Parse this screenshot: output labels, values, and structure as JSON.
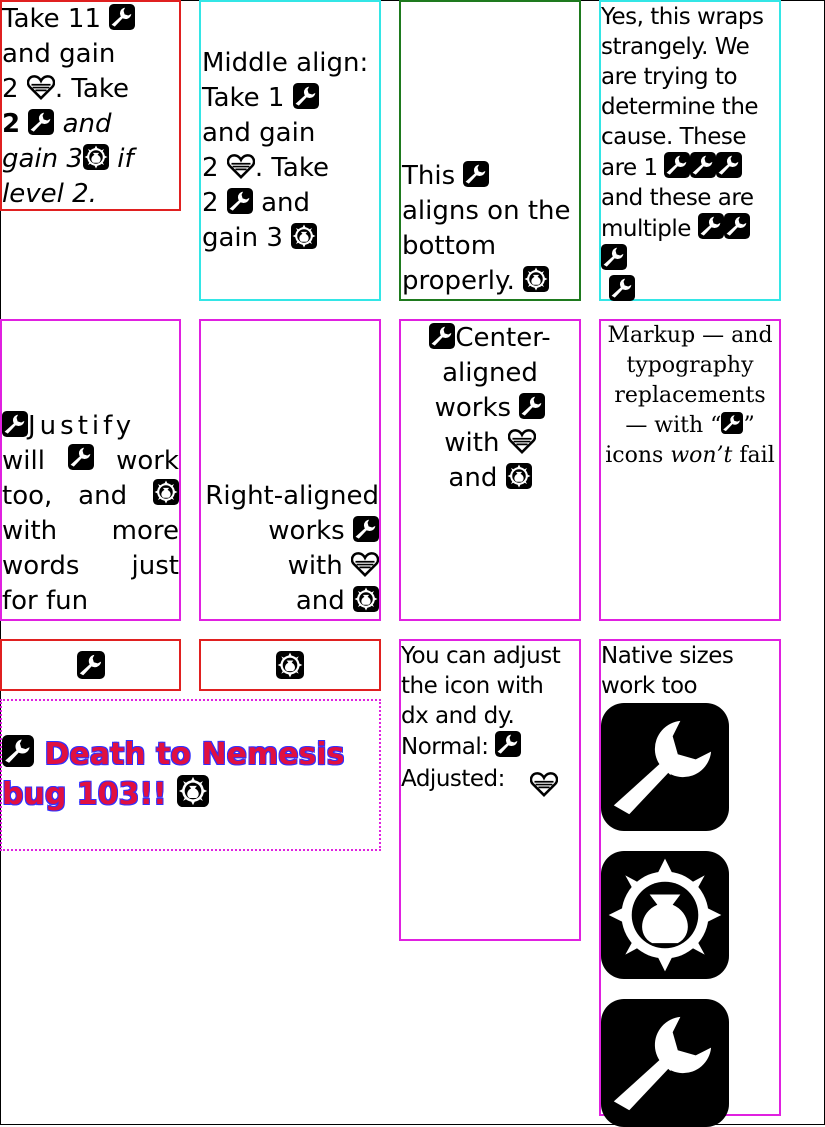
{
  "box1": {
    "t1": "Take 11",
    "t2": "and gain",
    "t3": "2",
    "t4": ". Take",
    "t5": "2",
    "t6": "and",
    "t7": "gain 3",
    "t8": "if",
    "t9": "level 2."
  },
  "box2": {
    "t1": "Middle align:",
    "t2": "Take 1",
    "t3": "and gain",
    "t4": "2",
    "t5": ". Take",
    "t6": "2",
    "t7": "and",
    "t8": "gain 3"
  },
  "box3": {
    "t1": "This",
    "t2": "aligns on the",
    "t3": "bottom",
    "t4": "properly."
  },
  "box4": {
    "t1": "Yes, this wraps",
    "t2": "strangely. We",
    "t3": "are trying to",
    "t4": "determine the",
    "t5": "cause. These",
    "t6": "are 1",
    "t7": "and these are",
    "t8": "multiple"
  },
  "box5": {
    "t1": "Justify",
    "t2": "will",
    "t3": "work",
    "t4": "too,",
    "t5": "and",
    "t6": "with",
    "t7": "more",
    "t8": "words",
    "t9": "just",
    "t10": "for fun"
  },
  "box6": {
    "t1": "Right-aligned",
    "t2": "works",
    "t3": "with",
    "t4": "and"
  },
  "box7": {
    "t1": "Center-",
    "t2": "aligned",
    "t3": "works",
    "t4": "with",
    "t5": "and"
  },
  "box8": {
    "t1": "Markup — and",
    "t2": "typography",
    "t3": "replacements",
    "t4": "— with “",
    "t5": "”",
    "t6": "icons",
    "t7": "won’t",
    "t8": "fail"
  },
  "box11": {
    "t1": "Death to Nemesis",
    "t2": "bug 103!!"
  },
  "box12": {
    "t1": "You can adjust",
    "t2": "the icon with",
    "t3": "dx and dy.",
    "t4": "Normal:",
    "t5": "Adjusted:"
  },
  "box13": {
    "t1": "Native sizes",
    "t2": "work too"
  },
  "colors": {
    "red": "#e02020",
    "cyan": "#33e6e6",
    "green": "#1e7a1e",
    "magenta": "#e020e0",
    "death_text": "#e01040",
    "death_outline": "#3030ff"
  },
  "icons": [
    "wrench-icon",
    "heart-icon",
    "coin-bag-icon"
  ]
}
